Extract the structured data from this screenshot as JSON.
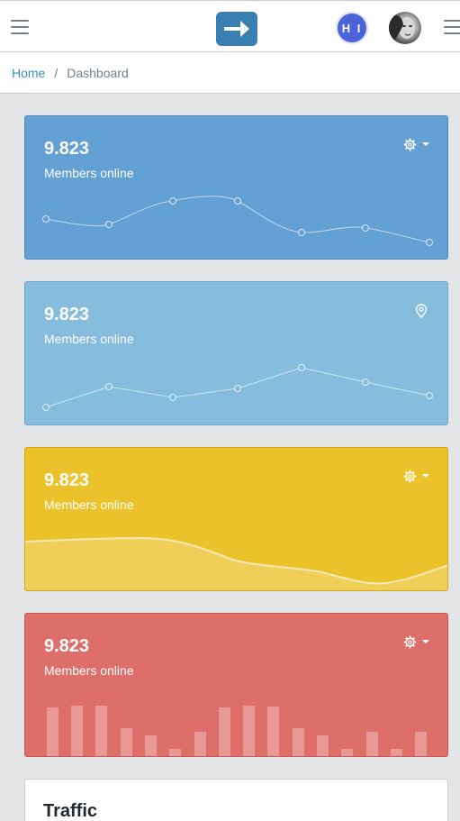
{
  "header": {
    "user_initials": "H I"
  },
  "breadcrumb": {
    "home": "Home",
    "separator": "/",
    "current": "Dashboard"
  },
  "cards": [
    {
      "value": "9.823",
      "label": "Members online",
      "color": "#63a0d4",
      "icon": "gear-icon",
      "chart": "line"
    },
    {
      "value": "9.823",
      "label": "Members online",
      "color": "#86bcdc",
      "icon": "location-pin-icon",
      "chart": "line"
    },
    {
      "value": "9.823",
      "label": "Members online",
      "color": "#ecc22a",
      "icon": "gear-icon",
      "chart": "area"
    },
    {
      "value": "9.823",
      "label": "Members online",
      "color": "#de6e69",
      "icon": "gear-icon",
      "chart": "bar"
    }
  ],
  "traffic": {
    "title": "Traffic"
  }
}
